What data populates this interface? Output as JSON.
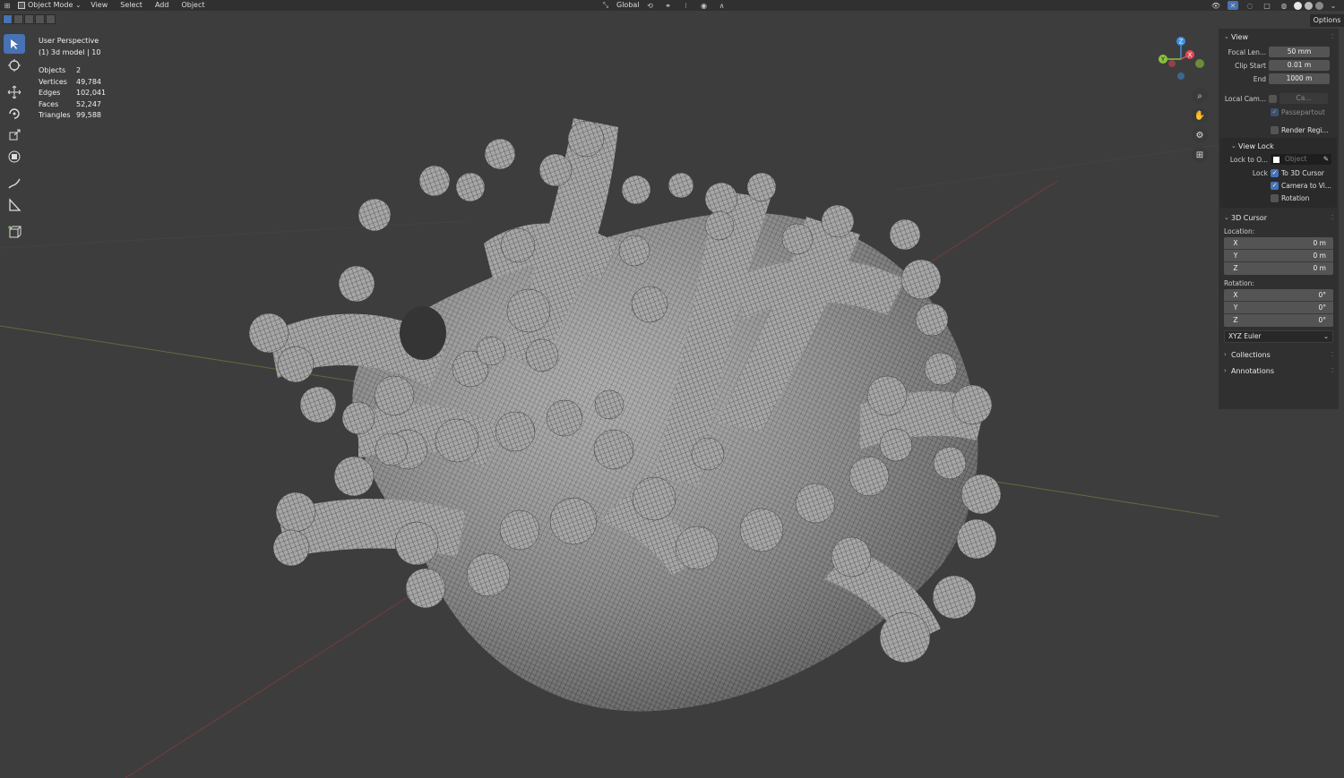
{
  "header": {
    "mode_label": "Object Mode",
    "menus": [
      "View",
      "Select",
      "Add",
      "Object"
    ],
    "orientation": "Global",
    "options_label": "Options"
  },
  "overlay": {
    "view_name": "User Perspective",
    "object_line": "(1) 3d model | 10",
    "stats": [
      {
        "label": "Objects",
        "value": "2"
      },
      {
        "label": "Vertices",
        "value": "49,784"
      },
      {
        "label": "Edges",
        "value": "102,041"
      },
      {
        "label": "Faces",
        "value": "52,247"
      },
      {
        "label": "Triangles",
        "value": "99,588"
      }
    ]
  },
  "gizmo": {
    "x": "X",
    "y": "Y",
    "z": "Z"
  },
  "npanel": {
    "view": {
      "title": "View",
      "focal_label": "Focal Len...",
      "focal_value": "50 mm",
      "clip_start_label": "Clip Start",
      "clip_start_value": "0.01 m",
      "end_label": "End",
      "end_value": "1000 m",
      "local_cam_label": "Local Cam...",
      "local_cam_value": "Ca...",
      "passepartout_label": "Passepartout",
      "render_region_label": "Render Regi..."
    },
    "view_lock": {
      "title": "View Lock",
      "lock_to_label": "Lock to O...",
      "lock_to_placeholder": "Object",
      "lock_label": "Lock",
      "to_cursor_label": "To 3D Cursor",
      "camera_to_view_label": "Camera to Vi...",
      "rotation_label": "Rotation"
    },
    "cursor": {
      "title": "3D Cursor",
      "location_label": "Location:",
      "location": [
        {
          "axis": "X",
          "value": "0 m"
        },
        {
          "axis": "Y",
          "value": "0 m"
        },
        {
          "axis": "Z",
          "value": "0 m"
        }
      ],
      "rotation_label": "Rotation:",
      "rotation": [
        {
          "axis": "X",
          "value": "0°"
        },
        {
          "axis": "Y",
          "value": "0°"
        },
        {
          "axis": "Z",
          "value": "0°"
        }
      ],
      "rotation_mode": "XYZ Euler"
    },
    "collections_title": "Collections",
    "annotations_title": "Annotations"
  },
  "colors": {
    "accent": "#4772b3",
    "axis_x": "#e14a55",
    "axis_y": "#8bc33a",
    "axis_z": "#3f8fe0",
    "model": "#a7a7a7"
  }
}
